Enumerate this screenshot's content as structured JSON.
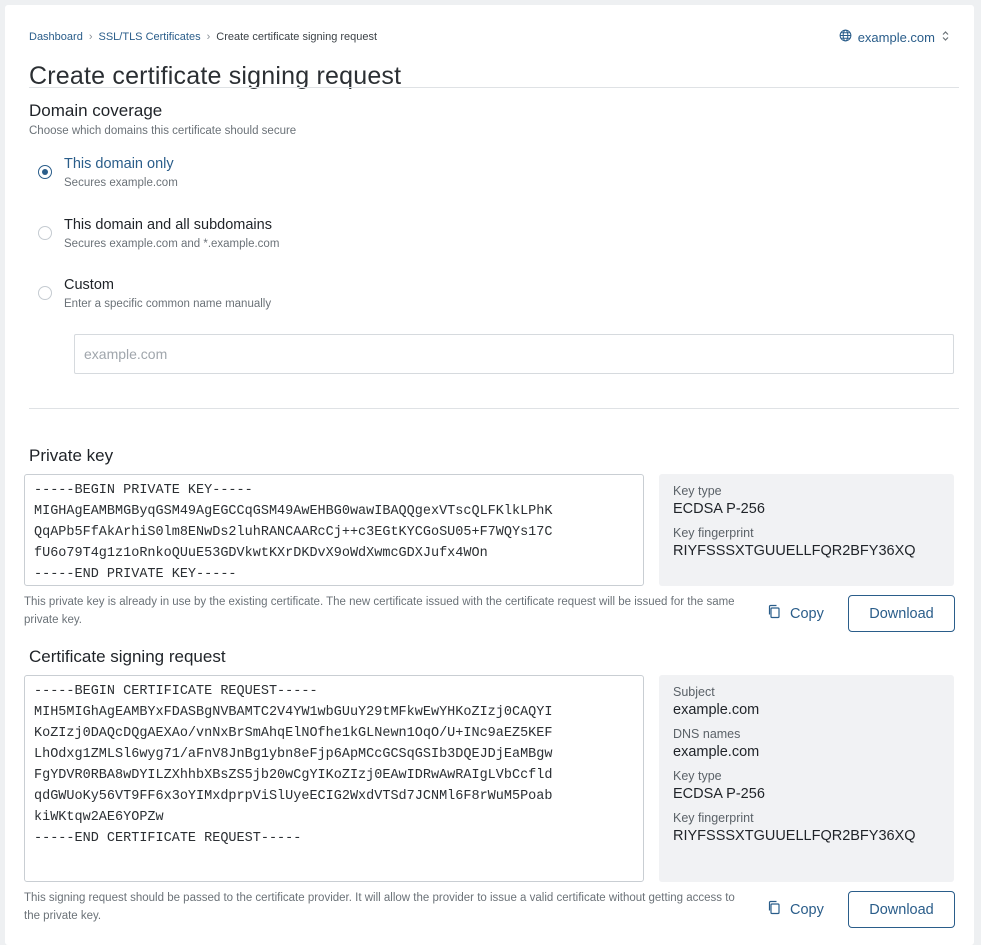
{
  "breadcrumb": {
    "items": [
      "Dashboard",
      "SSL/TLS Certificates"
    ],
    "current": "Create certificate signing request"
  },
  "domain_switcher": {
    "label": "example.com",
    "icon": "globe-icon"
  },
  "page_title": "Create certificate signing request",
  "domain_coverage": {
    "title": "Domain coverage",
    "subtitle": "Choose which domains this certificate should secure",
    "options": [
      {
        "label": "This domain only",
        "desc": "Secures example.com",
        "selected": true
      },
      {
        "label": "This domain and all subdomains",
        "desc": "Secures example.com and *.example.com",
        "selected": false
      },
      {
        "label": "Custom",
        "desc": "Enter a specific common name manually",
        "selected": false
      }
    ],
    "custom_input": {
      "placeholder": "example.com",
      "value": ""
    }
  },
  "private_key": {
    "title": "Private key",
    "pem": "-----BEGIN PRIVATE KEY-----\nMIGHAgEAMBMGByqGSM49AgEGCCqGSM49AwEHBG0wawIBAQQgexVTscQLFKlkLPhK\nQqAPb5FfAkArhiS0lm8ENwDs2luhRANCAARcCj++c3EGtKYCGoSU05+F7WQYs17C\nfU6o79T4g1z1oRnkoQUuE53GDVkwtKXrDKDvX9oWdXwmcGDXJufx4WOn\n-----END PRIVATE KEY-----",
    "info": [
      {
        "k": "Key type",
        "v": "ECDSA P-256"
      },
      {
        "k": "Key fingerprint",
        "v": "RIYFSSSXTGUUELLFQR2BFY36XQ"
      }
    ],
    "note": "This private key is already in use by the existing certificate. The new certificate issued with the certificate request will be issued for the same private key.",
    "copy_label": "Copy",
    "download_label": "Download"
  },
  "csr": {
    "title": "Certificate signing request",
    "pem": "-----BEGIN CERTIFICATE REQUEST-----\nMIH5MIGhAgEAMBYxFDASBgNVBAMTC2V4YW1wbGUuY29tMFkwEwYHKoZIzj0CAQYI\nKoZIzj0DAQcDQgAEXAo/vnNxBrSmAhqElNOfhe1kGLNewn1OqO/U+INc9aEZ5KEF\nLhOdxg1ZMLSl6wyg71/aFnV8JnBg1ybn8eFjp6ApMCcGCSqGSIb3DQEJDjEaMBgw\nFgYDVR0RBA8wDYILZXhhbXBsZS5jb20wCgYIKoZIzj0EAwIDRwAwRAIgLVbCcfld\nqdGWUoKy56VT9FF6x3oYIMxdprpViSlUyeECIG2WxdVTSd7JCNMl6F8rWuM5Poab\nkiWKtqw2AE6YOPZw\n-----END CERTIFICATE REQUEST-----",
    "info": [
      {
        "k": "Subject",
        "v": "example.com"
      },
      {
        "k": "DNS names",
        "v": "example.com"
      },
      {
        "k": "Key type",
        "v": "ECDSA P-256"
      },
      {
        "k": "Key fingerprint",
        "v": "RIYFSSSXTGUUELLFQR2BFY36XQ"
      }
    ],
    "note": "This signing request should be passed to the certificate provider. It will allow the provider to issue a valid certificate without getting access to the private key.",
    "copy_label": "Copy",
    "download_label": "Download"
  },
  "colors": {
    "accent": "#2a5d8a",
    "muted": "#6b7278",
    "panel": "#f1f2f4"
  }
}
